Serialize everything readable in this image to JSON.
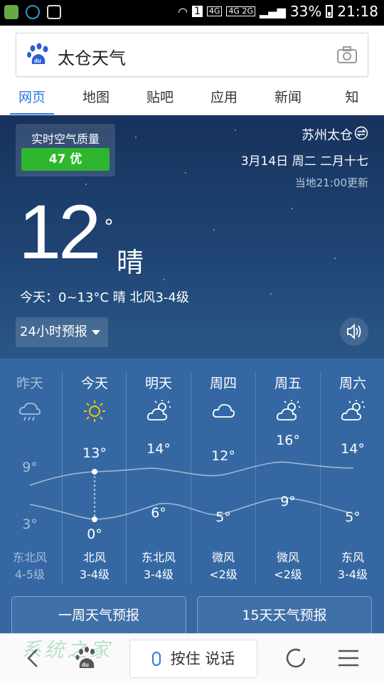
{
  "status_bar": {
    "battery": "33%",
    "time": "21:18",
    "net1": "4G",
    "net2": "4G 2G"
  },
  "search": {
    "query": "太仓天气"
  },
  "tabs": [
    {
      "label": "网页",
      "active": true
    },
    {
      "label": "地图"
    },
    {
      "label": "贴吧"
    },
    {
      "label": "应用"
    },
    {
      "label": "新闻"
    },
    {
      "label": "知"
    }
  ],
  "weather": {
    "air_quality": {
      "label": "实时空气质量",
      "value": "47 优",
      "color": "#2fb62f"
    },
    "city": "苏州太仓",
    "date": "3月14日 周二 二月十七",
    "update_time": "当地21:00更新",
    "current_temp": "12",
    "degree": "°",
    "condition": "晴",
    "today_summary": "今天：0~13°C  晴 北风3-4级",
    "forecast_label": "24小时预报"
  },
  "forecast": [
    {
      "day": "昨天",
      "icon": "rain-cloud-icon",
      "high": "9°",
      "low": "3°",
      "wind": "东北风",
      "level": "4-5级",
      "past": true
    },
    {
      "day": "今天",
      "icon": "sun-icon",
      "high": "13°",
      "low": "0°",
      "wind": "北风",
      "level": "3-4级"
    },
    {
      "day": "明天",
      "icon": "partly-cloudy-icon",
      "high": "14°",
      "low": "6°",
      "wind": "东北风",
      "level": "3-4级"
    },
    {
      "day": "周四",
      "icon": "cloud-icon",
      "high": "12°",
      "low": "5°",
      "wind": "微风",
      "level": "<2级"
    },
    {
      "day": "周五",
      "icon": "partly-cloudy-icon",
      "high": "16°",
      "low": "9°",
      "wind": "微风",
      "level": "<2级"
    },
    {
      "day": "周六",
      "icon": "partly-cloudy-icon",
      "high": "14°",
      "low": "5°",
      "wind": "东风",
      "level": "3-4级"
    }
  ],
  "buttons": {
    "week": "一周天气预报",
    "fifteen": "15天天气预报"
  },
  "bottom_nav": {
    "voice": "按住 说话"
  },
  "colors": {
    "accent": "#2a7ae2",
    "sky_top": "#17325c",
    "sky_bottom": "#3568a3",
    "aq_good": "#2fb62f"
  }
}
